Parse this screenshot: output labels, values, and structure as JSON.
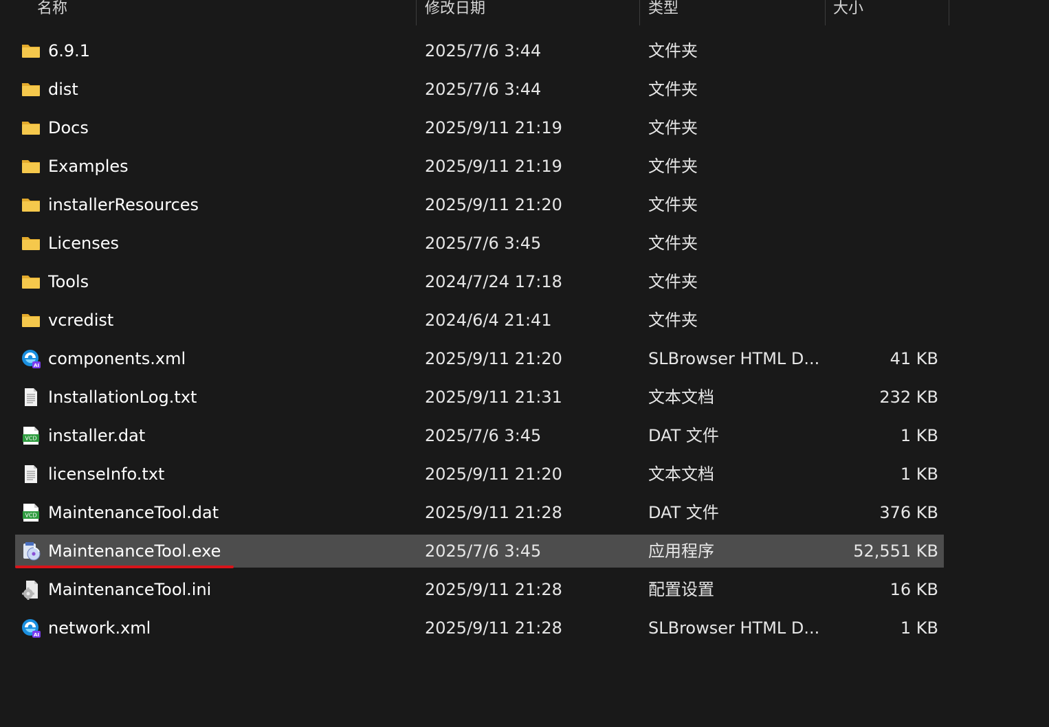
{
  "columns": {
    "name": "名称",
    "date": "修改日期",
    "type": "类型",
    "size": "大小"
  },
  "files": [
    {
      "name": "6.9.1",
      "date": "2025/7/6 3:44",
      "type": "文件夹",
      "size": "",
      "icon": "folder-icon"
    },
    {
      "name": "dist",
      "date": "2025/7/6 3:44",
      "type": "文件夹",
      "size": "",
      "icon": "folder-icon"
    },
    {
      "name": "Docs",
      "date": "2025/9/11 21:19",
      "type": "文件夹",
      "size": "",
      "icon": "folder-icon"
    },
    {
      "name": "Examples",
      "date": "2025/9/11 21:19",
      "type": "文件夹",
      "size": "",
      "icon": "folder-icon"
    },
    {
      "name": "installerResources",
      "date": "2025/9/11 21:20",
      "type": "文件夹",
      "size": "",
      "icon": "folder-icon"
    },
    {
      "name": "Licenses",
      "date": "2025/7/6 3:45",
      "type": "文件夹",
      "size": "",
      "icon": "folder-icon"
    },
    {
      "name": "Tools",
      "date": "2024/7/24 17:18",
      "type": "文件夹",
      "size": "",
      "icon": "folder-icon"
    },
    {
      "name": "vcredist",
      "date": "2024/6/4 21:41",
      "type": "文件夹",
      "size": "",
      "icon": "folder-icon"
    },
    {
      "name": "components.xml",
      "date": "2025/9/11 21:20",
      "type": "SLBrowser HTML D...",
      "size": "41 KB",
      "icon": "browser-html-icon"
    },
    {
      "name": "InstallationLog.txt",
      "date": "2025/9/11 21:31",
      "type": "文本文档",
      "size": "232 KB",
      "icon": "text-file-icon"
    },
    {
      "name": "installer.dat",
      "date": "2025/7/6 3:45",
      "type": "DAT 文件",
      "size": "1 KB",
      "icon": "vcd-file-icon"
    },
    {
      "name": "licenseInfo.txt",
      "date": "2025/9/11 21:20",
      "type": "文本文档",
      "size": "1 KB",
      "icon": "text-file-icon"
    },
    {
      "name": "MaintenanceTool.dat",
      "date": "2025/9/11 21:28",
      "type": "DAT 文件",
      "size": "376 KB",
      "icon": "vcd-file-icon"
    },
    {
      "name": "MaintenanceTool.exe",
      "date": "2025/7/6 3:45",
      "type": "应用程序",
      "size": "52,551 KB",
      "icon": "installer-exe-icon"
    },
    {
      "name": "MaintenanceTool.ini",
      "date": "2025/9/11 21:28",
      "type": "配置设置",
      "size": "16 KB",
      "icon": "config-file-icon"
    },
    {
      "name": "network.xml",
      "date": "2025/9/11 21:28",
      "type": "SLBrowser HTML D...",
      "size": "1 KB",
      "icon": "browser-html-icon"
    }
  ],
  "colors": {
    "background": "#191919",
    "selected_row": "#4d4d4d",
    "annotation_underline": "#d8141b",
    "folder": "#f5c84c"
  }
}
